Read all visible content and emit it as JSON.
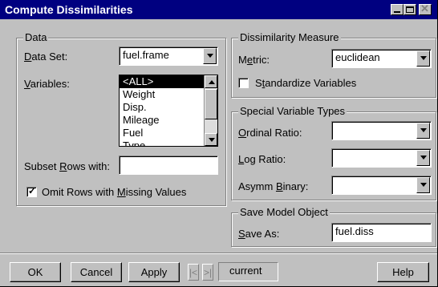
{
  "window": {
    "title": "Compute Dissimilarities"
  },
  "data_group": {
    "title": "Data",
    "data_set_label_pre": "",
    "data_set_label_key": "D",
    "data_set_label_post": "ata Set:",
    "data_set_value": "fuel.frame",
    "variables_label_key": "V",
    "variables_label_post": "ariables:",
    "variables_items": [
      "<ALL>",
      "Weight",
      "Disp.",
      "Mileage",
      "Fuel",
      "Type"
    ],
    "variables_selected": "<ALL>",
    "subset_label_pre": "Subset ",
    "subset_label_key": "R",
    "subset_label_post": "ows with:",
    "subset_value": "",
    "omit_label_pre": "Omit Rows with ",
    "omit_label_key": "M",
    "omit_label_post": "issing Values",
    "omit_checked": true
  },
  "dissimilarity_group": {
    "title": "Dissimilarity Measure",
    "metric_label_pre": "M",
    "metric_label_key": "e",
    "metric_label_post": "tric:",
    "metric_value": "euclidean",
    "standardize_label_pre": "S",
    "standardize_label_key": "t",
    "standardize_label_post": "andardize Variables",
    "standardize_checked": false
  },
  "special_group": {
    "title": "Special Variable Types",
    "ordinal_label_key": "O",
    "ordinal_label_post": "rdinal Ratio:",
    "ordinal_value": "",
    "log_label_key": "L",
    "log_label_post": "og Ratio:",
    "log_value": "",
    "asymm_label_pre": "Asymm ",
    "asymm_label_key": "B",
    "asymm_label_post": "inary:",
    "asymm_value": ""
  },
  "save_group": {
    "title": "Save Model Object",
    "save_label_key": "S",
    "save_label_post": "ave As:",
    "save_value": "fuel.diss"
  },
  "buttons": {
    "ok": "OK",
    "cancel": "Cancel",
    "apply": "Apply",
    "prev": "|<",
    "next": ">|",
    "current": "current",
    "help": "Help"
  }
}
